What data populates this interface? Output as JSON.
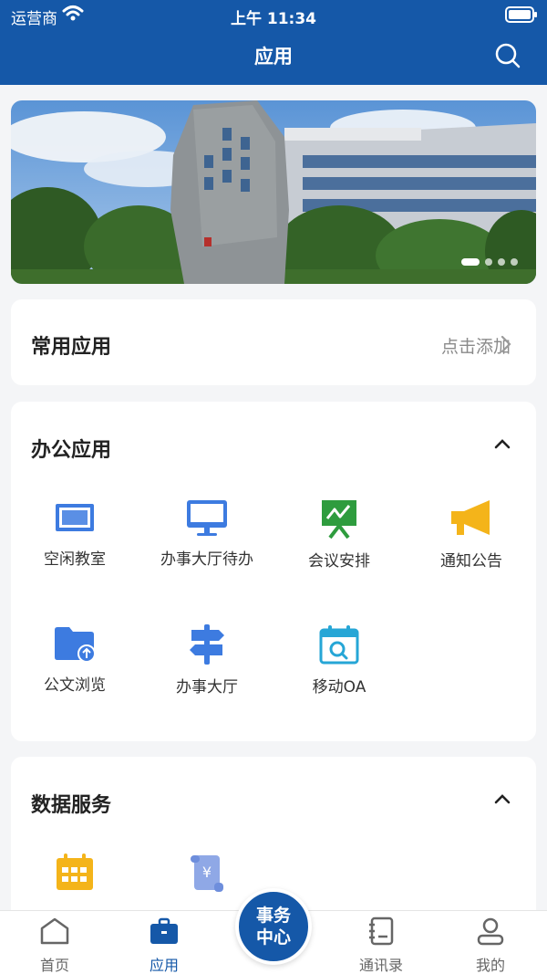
{
  "status": {
    "carrier": "运营商",
    "time": "上午 11:34"
  },
  "header": {
    "title": "应用"
  },
  "banner": {
    "slides": 4,
    "active_slide": 1
  },
  "common": {
    "title": "常用应用",
    "action": "点击添加"
  },
  "office": {
    "title": "办公应用",
    "apps": [
      {
        "label": "空闲教室",
        "icon": "classroom-screen-icon"
      },
      {
        "label": "办事大厅待办",
        "icon": "monitor-icon"
      },
      {
        "label": "会议安排",
        "icon": "meeting-board-icon"
      },
      {
        "label": "通知公告",
        "icon": "megaphone-icon"
      },
      {
        "label": "公文浏览",
        "icon": "folder-upload-icon"
      },
      {
        "label": "办事大厅",
        "icon": "signpost-icon"
      },
      {
        "label": "移动OA",
        "icon": "calendar-search-icon"
      }
    ]
  },
  "data_service": {
    "title": "数据服务",
    "apps": [
      {
        "icon": "calendar-grid-icon"
      },
      {
        "icon": "yuan-receipt-icon"
      }
    ]
  },
  "tabbar": {
    "tabs": [
      {
        "label": "首页",
        "icon": "home-icon",
        "active": false
      },
      {
        "label": "应用",
        "icon": "briefcase-icon",
        "active": true
      },
      {
        "label": "通讯录",
        "icon": "contacts-book-icon",
        "active": false
      },
      {
        "label": "我的",
        "icon": "user-icon",
        "active": false
      }
    ],
    "center": {
      "line1": "事务",
      "line2": "中心"
    }
  },
  "colors": {
    "brand": "#1558a8",
    "blue_icon": "#3d7be0",
    "green_icon": "#2e9c3e",
    "yellow_icon": "#f4b41a",
    "cyan_icon": "#26a6d6"
  }
}
